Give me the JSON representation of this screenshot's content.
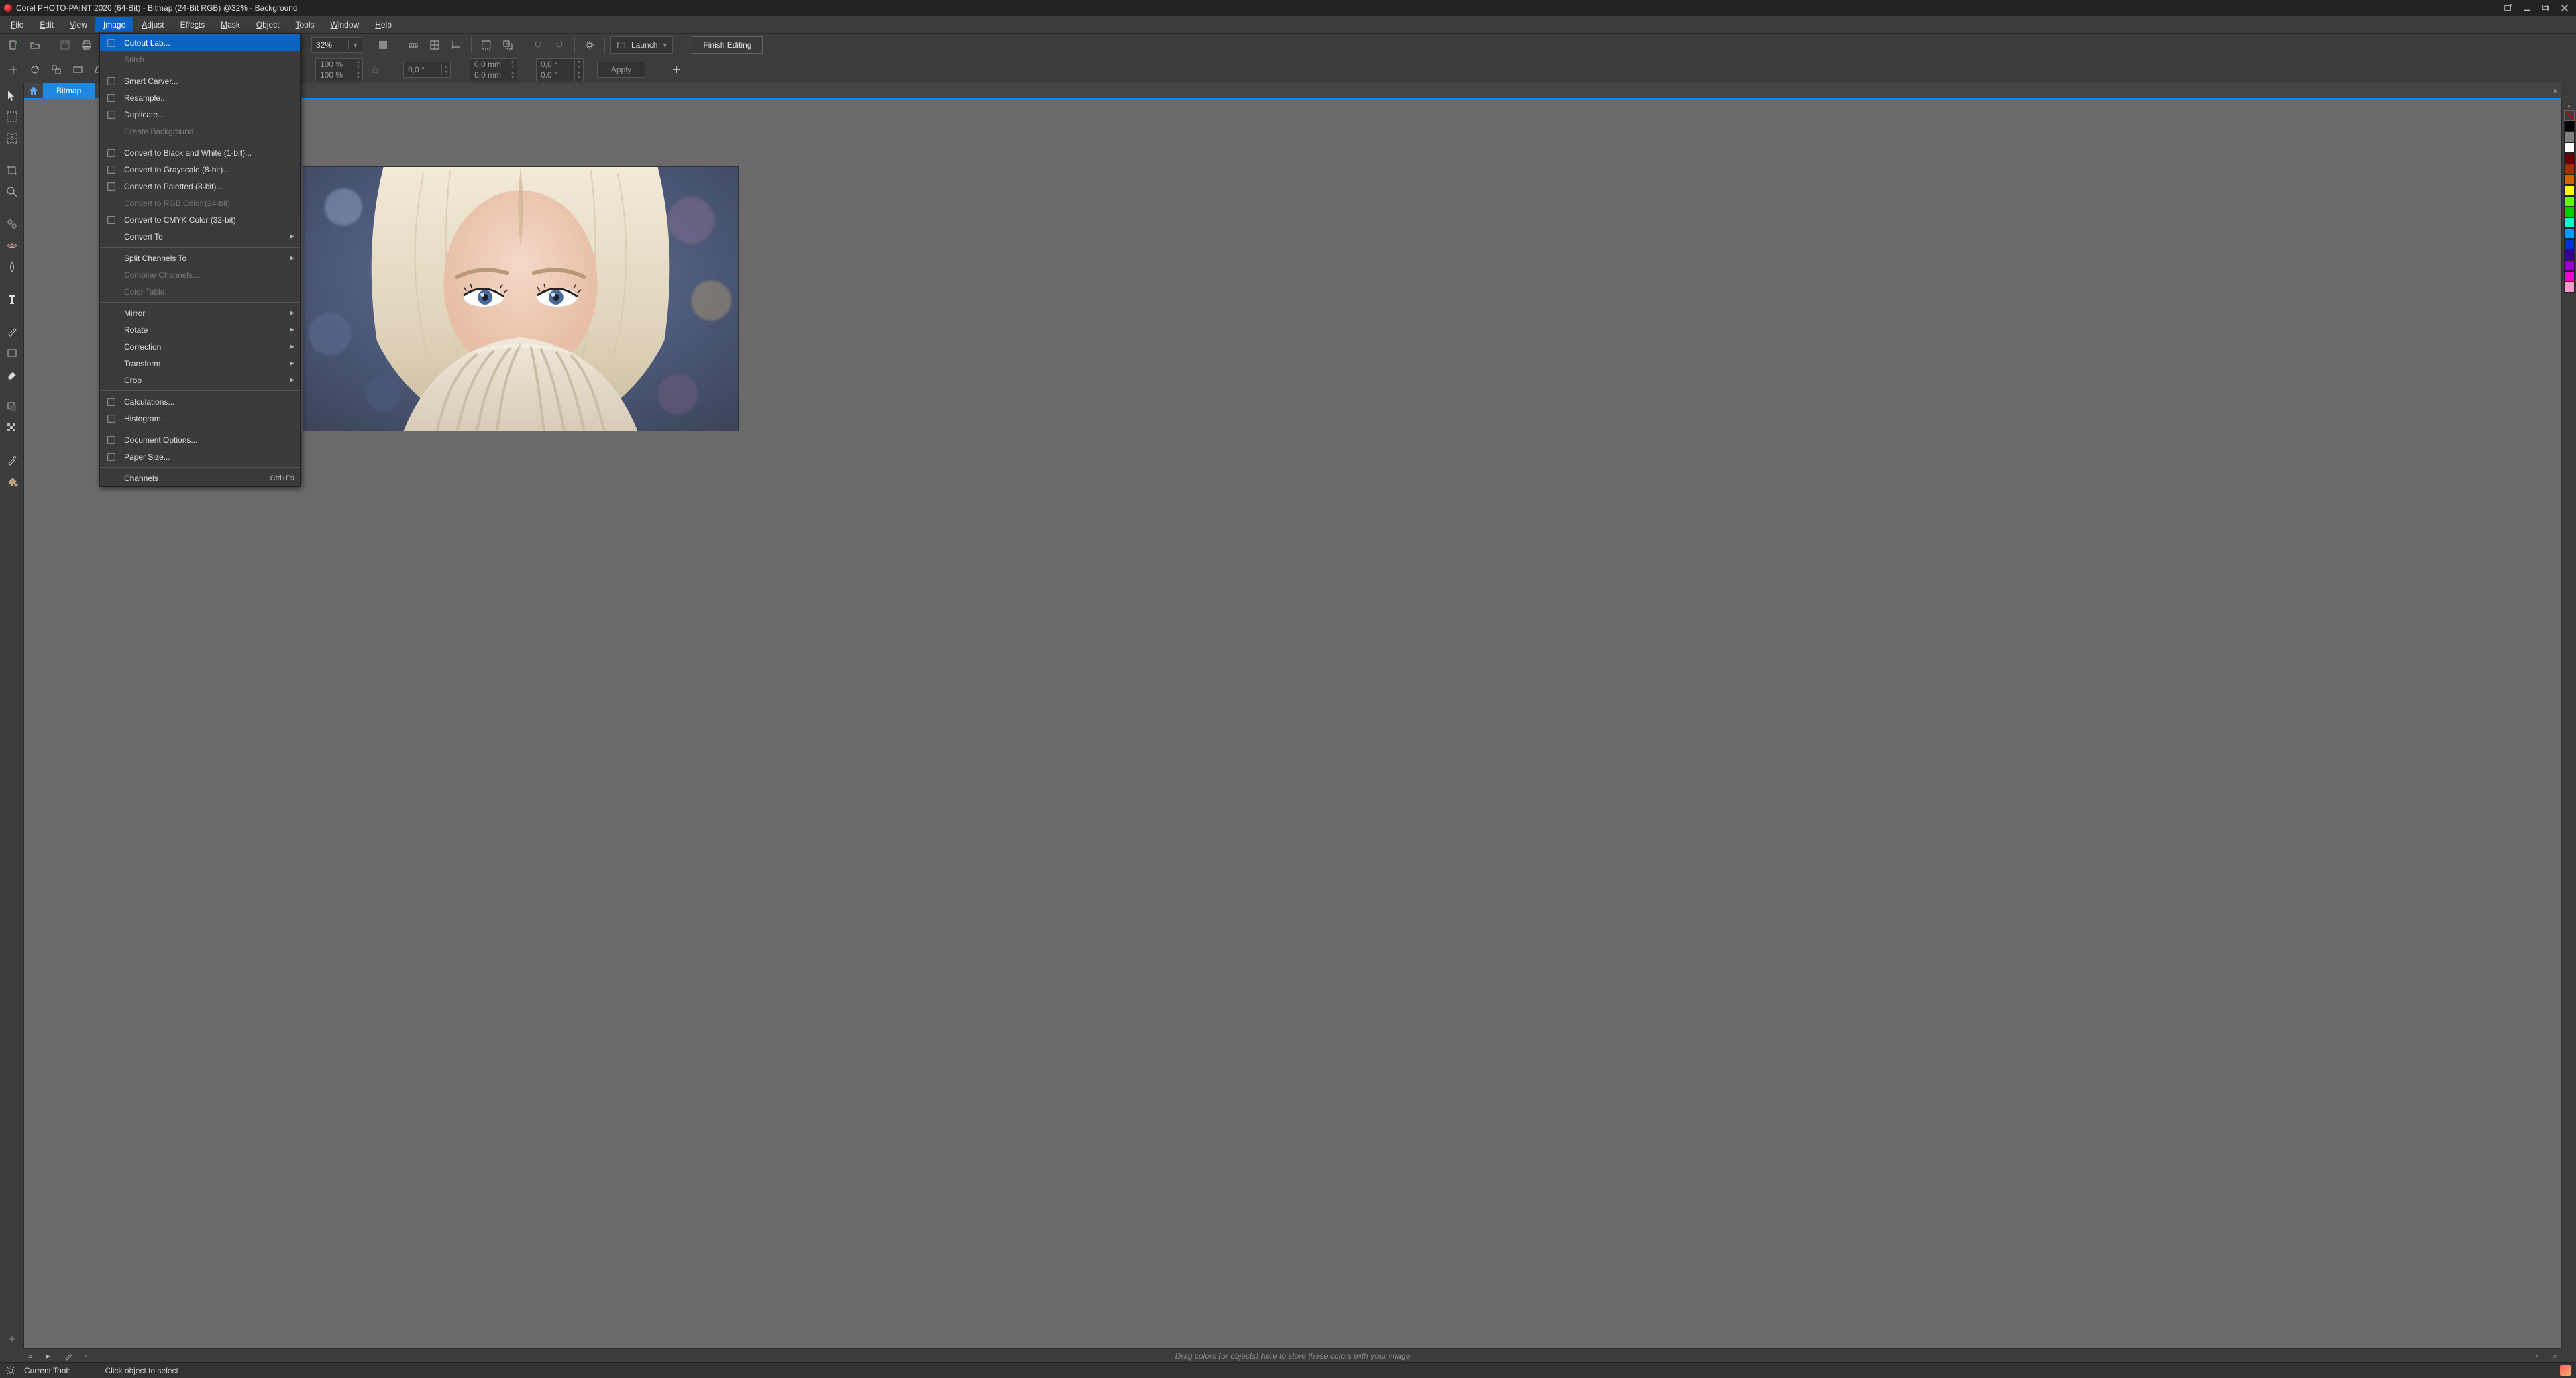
{
  "app": {
    "title": "Corel PHOTO-PAINT 2020 (64-Bit) - Bitmap (24-Bit RGB) @32% - Background"
  },
  "menubar": [
    {
      "label": "File",
      "ul": "F",
      "rest": "ile"
    },
    {
      "label": "Edit",
      "ul": "E",
      "rest": "dit"
    },
    {
      "label": "View",
      "ul": "V",
      "rest": "iew"
    },
    {
      "label": "Image",
      "ul": "I",
      "rest": "mage",
      "active": true
    },
    {
      "label": "Adjust",
      "ul": "A",
      "rest": "djust"
    },
    {
      "label": "Effects",
      "ul": "c",
      "pre": "Effe",
      "post": "ts"
    },
    {
      "label": "Mask",
      "ul": "M",
      "rest": "ask"
    },
    {
      "label": "Object",
      "ul": "O",
      "rest": "bject"
    },
    {
      "label": "Tools",
      "ul": "T",
      "rest": "ools"
    },
    {
      "label": "Window",
      "ul": "W",
      "rest": "indow"
    },
    {
      "label": "Help",
      "ul": "H",
      "rest": "elp"
    }
  ],
  "toolbar": {
    "zoom": "32%",
    "launch": "Launch",
    "finish": "Finish Editing"
  },
  "propbar": {
    "scalex": "100 %",
    "scaley": "100 %",
    "angle": "0,0 °",
    "dx": "0,0 mm",
    "dy": "0,0 mm",
    "sk1": "0,0 °",
    "sk2": "0,0 °",
    "apply": "Apply"
  },
  "doctab": "Bitmap",
  "dropdown": {
    "items": [
      {
        "type": "item",
        "label": "Cutout Lab...",
        "icon": "scissors",
        "hl": true
      },
      {
        "type": "item",
        "label": "Stitch...",
        "disabled": true
      },
      {
        "type": "sep"
      },
      {
        "type": "item",
        "label": "Smart Carver...",
        "icon": "carver"
      },
      {
        "type": "item",
        "label": "Resample...",
        "icon": "resample"
      },
      {
        "type": "item",
        "label": "Duplicate...",
        "icon": "duplicate"
      },
      {
        "type": "item",
        "label": "Create Background",
        "disabled": true
      },
      {
        "type": "sep"
      },
      {
        "type": "item",
        "label": "Convert to Black and White (1-bit)...",
        "icon": "bw"
      },
      {
        "type": "item",
        "label": "Convert to Grayscale (8-bit)...",
        "icon": "gray"
      },
      {
        "type": "item",
        "label": "Convert to Paletted (8-bit)...",
        "icon": "pal"
      },
      {
        "type": "item",
        "label": "Convert to RGB Color (24-bit)",
        "disabled": true
      },
      {
        "type": "item",
        "label": "Convert to CMYK Color (32-bit)",
        "icon": "cmyk"
      },
      {
        "type": "item",
        "label": "Convert To",
        "submenu": true
      },
      {
        "type": "sep"
      },
      {
        "type": "item",
        "label": "Split Channels To",
        "submenu": true
      },
      {
        "type": "item",
        "label": "Combine Channels...",
        "disabled": true
      },
      {
        "type": "item",
        "label": "Color Table...",
        "disabled": true
      },
      {
        "type": "sep"
      },
      {
        "type": "item",
        "label": "Mirror",
        "submenu": true
      },
      {
        "type": "item",
        "label": "Rotate",
        "submenu": true
      },
      {
        "type": "item",
        "label": "Correction",
        "submenu": true
      },
      {
        "type": "item",
        "label": "Transform",
        "submenu": true
      },
      {
        "type": "item",
        "label": "Crop",
        "submenu": true
      },
      {
        "type": "sep"
      },
      {
        "type": "item",
        "label": "Calculations...",
        "icon": "calc"
      },
      {
        "type": "item",
        "label": "Histogram...",
        "icon": "histo"
      },
      {
        "type": "sep"
      },
      {
        "type": "item",
        "label": "Document Options...",
        "icon": "doc"
      },
      {
        "type": "item",
        "label": "Paper Size...",
        "icon": "paper"
      },
      {
        "type": "sep"
      },
      {
        "type": "item",
        "label": "Channels",
        "accel": "Ctrl+F9"
      }
    ]
  },
  "palette_colors": [
    "#000000",
    "#7f7f7f",
    "#ffffff",
    "#660000",
    "#993300",
    "#cc6600",
    "#ffff00",
    "#66ff00",
    "#00cc00",
    "#00ffcc",
    "#0099ff",
    "#0033cc",
    "#330099",
    "#9900cc",
    "#ff00cc",
    "#ff99cc"
  ],
  "dragbar_hint": "Drag colors (or objects) here to store these colors with your image",
  "statusbar": {
    "tool_label": "Current Tool:",
    "tool_hint": "Click object to select"
  }
}
